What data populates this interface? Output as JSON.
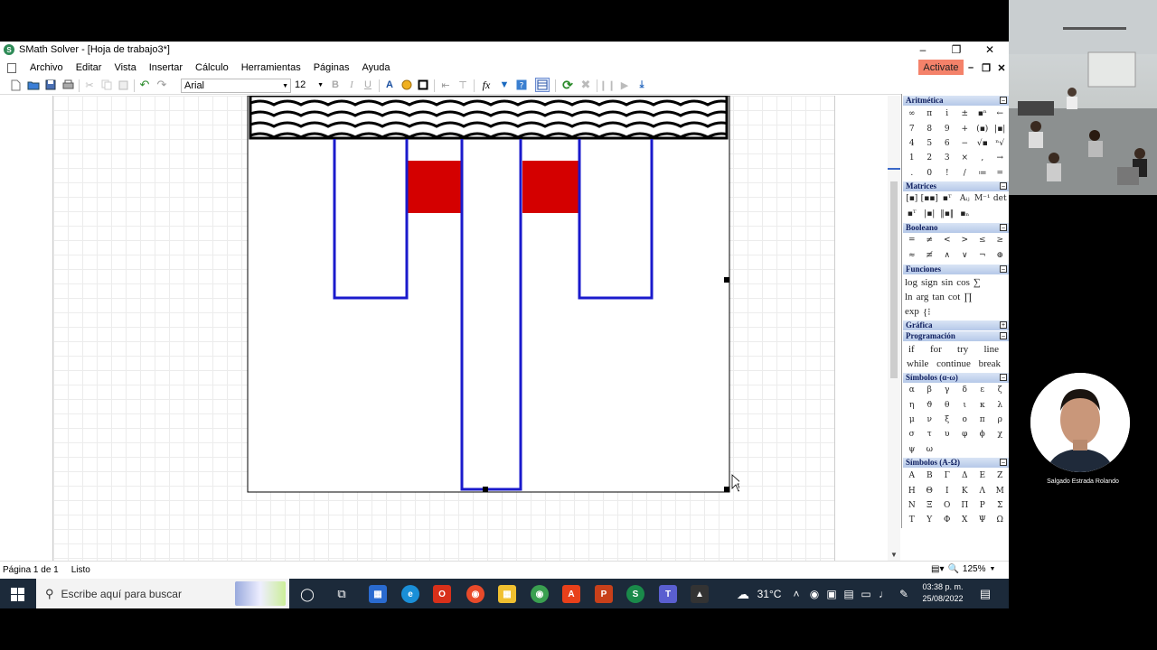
{
  "window": {
    "title": "SMath Solver - [Hoja de trabajo3*]",
    "app_icon": "S"
  },
  "menu": {
    "items": [
      "Archivo",
      "Editar",
      "Vista",
      "Insertar",
      "Cálculo",
      "Herramientas",
      "Páginas",
      "Ayuda"
    ],
    "activate_label": "Activate"
  },
  "toolbar": {
    "font": "Arial",
    "size": "12",
    "bold": "B",
    "italic": "I",
    "underline": "U",
    "function": "fx"
  },
  "colors": {
    "wall_stroke": "#1a1acc",
    "fill_red": "#d40000",
    "accent": "#f4826a",
    "panel_header": "#c4d3ee"
  },
  "panel": {
    "arithmetic": {
      "title": "Aritmética",
      "cells": [
        "∞",
        "π",
        "i",
        "±",
        "▪ⁿ",
        "←",
        "7",
        "8",
        "9",
        "+",
        "(▪)",
        "|▪|",
        "4",
        "5",
        "6",
        "−",
        "√▪",
        "ⁿ√",
        "1",
        "2",
        "3",
        "×",
        ",",
        "→",
        ".",
        "0",
        "!",
        "/",
        "≔",
        "="
      ]
    },
    "matrices": {
      "title": "Matrices",
      "cells": [
        "[▪]",
        "[▪▪]",
        "▪ᵀ",
        "Aᵢⱼ",
        "M⁻¹",
        "det",
        "▪ᵀ",
        "|▪|",
        "‖▪‖",
        "▪ₙ",
        "",
        ""
      ]
    },
    "boolean": {
      "title": "Booleano",
      "cells": [
        "=",
        "≠",
        "<",
        ">",
        "≤",
        "≥",
        "≈",
        "≢",
        "∧",
        "∨",
        "¬",
        "⊕"
      ]
    },
    "functions": {
      "title": "Funciones",
      "rows": [
        [
          "log",
          "sign",
          "sin",
          "cos",
          "∑"
        ],
        [
          "ln",
          "arg",
          "tan",
          "cot",
          "∏"
        ],
        [
          "exp",
          "{⁝"
        ]
      ]
    },
    "graph": {
      "title": "Gráfica"
    },
    "programming": {
      "title": "Programación",
      "rows": [
        [
          "if",
          "for",
          "try",
          "line"
        ],
        [
          "while",
          "continue",
          "break"
        ]
      ]
    },
    "greek_lower": {
      "title": "Símbolos (α-ω)",
      "cells": [
        "α",
        "β",
        "γ",
        "δ",
        "ε",
        "ζ",
        "η",
        "ϑ",
        "θ",
        "ι",
        "κ",
        "λ",
        "μ",
        "ν",
        "ξ",
        "ο",
        "π",
        "ρ",
        "σ",
        "τ",
        "υ",
        "φ",
        "ϕ",
        "χ",
        "ψ",
        "ω",
        "",
        "",
        "",
        ""
      ]
    },
    "greek_upper": {
      "title": "Símbolos (A-Ω)",
      "cells": [
        "Α",
        "Β",
        "Γ",
        "Δ",
        "Ε",
        "Ζ",
        "Η",
        "Θ",
        "Ι",
        "Κ",
        "Λ",
        "Μ",
        "Ν",
        "Ξ",
        "Ο",
        "Π",
        "Ρ",
        "Σ",
        "Τ",
        "Υ",
        "Φ",
        "Χ",
        "Ψ",
        "Ω"
      ]
    }
  },
  "status": {
    "page": "Página 1 de 1",
    "state": "Listo",
    "zoom": "125%"
  },
  "taskbar": {
    "search_placeholder": "Escribe aquí para buscar",
    "weather": "31°C",
    "time": "03:38 p. m.",
    "date": "25/08/2022"
  },
  "video": {
    "participant_name": "Salgado Estrada Rolando"
  }
}
